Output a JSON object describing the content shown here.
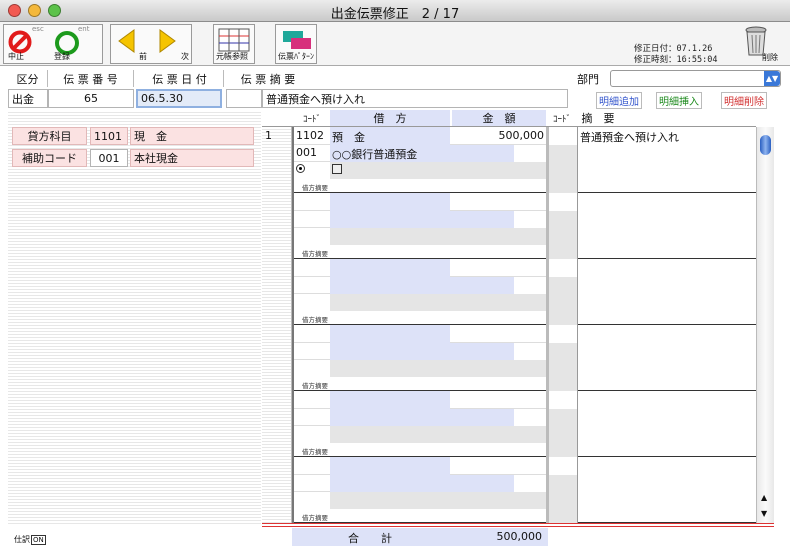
{
  "window": {
    "title": "出金伝票修正　2 / 17"
  },
  "toolbar": {
    "cancel": {
      "label": "中止",
      "shortcut": "esc"
    },
    "register": {
      "label": "登録",
      "shortcut": "ent"
    },
    "prev": {
      "label": "前"
    },
    "next": {
      "label": "次"
    },
    "ledger": {
      "label": "元帳参照"
    },
    "pattern": {
      "label": "伝票ﾊﾟﾀｰﾝ"
    },
    "modified_date": "修正日付：07.1.26",
    "modified_time": "修正時刻：16:55:04",
    "delete": {
      "label": "削除"
    }
  },
  "header": {
    "kubun_label": "区分",
    "number_label": "伝 票 番 号",
    "date_label": "伝 票 日 付",
    "summary_label": "伝 票 摘 要",
    "dept_label": "部門",
    "kubun": "出金",
    "number": "65",
    "date": "06.5.30",
    "summary": "普通預金へ預け入れ",
    "dept": ""
  },
  "actions": {
    "add_detail": "明細追加",
    "insert_detail": "明細挿入",
    "delete_detail": "明細削除"
  },
  "left": {
    "credit_label": "貸方科目",
    "credit_code": "1101",
    "credit_name": "現　金",
    "sub_label": "補助コード",
    "sub_code": "001",
    "sub_name": "本社現金"
  },
  "columns": {
    "code": "ｺｰﾄﾞ",
    "debit": "借　方",
    "amount": "金　額",
    "code2": "ｺｰﾄﾞ",
    "memo": "摘　要"
  },
  "rows": [
    {
      "no": "1",
      "code": "1102",
      "account": "預　金",
      "amount": "500,000",
      "sub_code": "001",
      "sub_name": "○○銀行普通預金",
      "memo": "普通預金へ預け入れ",
      "memo_label": "借方摘要"
    },
    {
      "no": "",
      "code": "",
      "account": "",
      "amount": "",
      "sub_code": "",
      "sub_name": "",
      "memo": "",
      "memo_label": "借方摘要"
    },
    {
      "no": "",
      "code": "",
      "account": "",
      "amount": "",
      "sub_code": "",
      "sub_name": "",
      "memo": "",
      "memo_label": "借方摘要"
    },
    {
      "no": "",
      "code": "",
      "account": "",
      "amount": "",
      "sub_code": "",
      "sub_name": "",
      "memo": "",
      "memo_label": "借方摘要"
    },
    {
      "no": "",
      "code": "",
      "account": "",
      "amount": "",
      "sub_code": "",
      "sub_name": "",
      "memo": "",
      "memo_label": "借方摘要"
    },
    {
      "no": "",
      "code": "",
      "account": "",
      "amount": "",
      "sub_code": "",
      "sub_name": "",
      "memo": "",
      "memo_label": "借方摘要"
    }
  ],
  "total": {
    "label": "合　　計",
    "value": "500,000"
  },
  "footer": {
    "input_label": "仕訳",
    "toggle": "ON"
  },
  "colors": {
    "pink": "#fbe2e2",
    "blue": "#dde2f8",
    "accent": "#3a78d8"
  }
}
